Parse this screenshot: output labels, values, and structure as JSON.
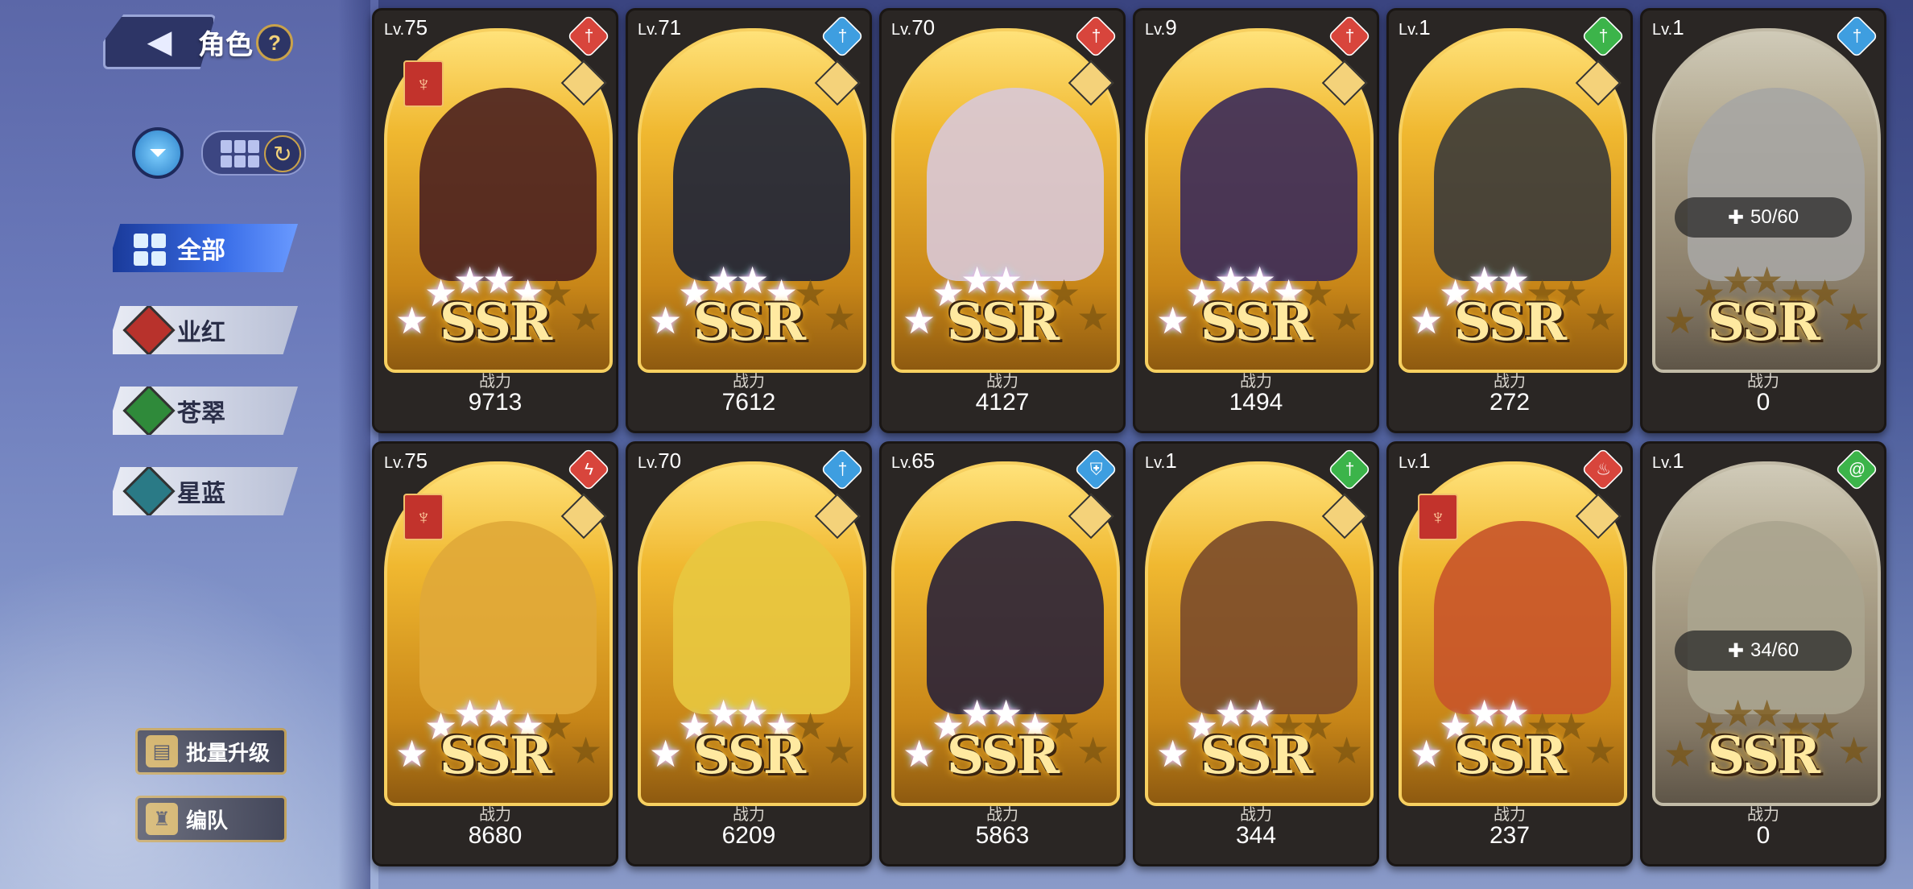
{
  "header": {
    "title": "角色",
    "help_label": "?"
  },
  "categories": [
    {
      "label": "全部",
      "active": true
    },
    {
      "label": "业红",
      "gem_color": "#b8322c"
    },
    {
      "label": "苍翠",
      "gem_color": "#2f8a3a"
    },
    {
      "label": "星蓝",
      "gem_color": "#2a7a86"
    }
  ],
  "buttons": {
    "batch_upgrade": "批量升级",
    "team": "编队"
  },
  "rarity_label": "SSR",
  "power_label": "战力",
  "level_prefix": "Lv.",
  "colors": {
    "red": "#d8453c",
    "blue": "#3e9ee0",
    "green": "#3cb44a",
    "gold": "#f0b830"
  },
  "cards": [
    {
      "level": "75",
      "element": "red",
      "element_icon": "sword-icon",
      "badge": true,
      "stars": 5,
      "power": "9713",
      "portrait": "#4a2020"
    },
    {
      "level": "71",
      "element": "blue",
      "element_icon": "sword-icon",
      "badge": false,
      "stars": 5,
      "power": "7612",
      "portrait": "#1c2238"
    },
    {
      "level": "70",
      "element": "red",
      "element_icon": "sword-icon",
      "badge": false,
      "stars": 5,
      "power": "4127",
      "portrait": "#d8c8d8"
    },
    {
      "level": "9",
      "element": "red",
      "element_icon": "sword-icon",
      "badge": false,
      "stars": 5,
      "power": "1494",
      "portrait": "#3a2a5a"
    },
    {
      "level": "1",
      "element": "green",
      "element_icon": "sword-icon",
      "badge": false,
      "stars": 4,
      "power": "272",
      "portrait": "#3a3a3a"
    },
    {
      "level": "1",
      "element": "blue",
      "element_icon": "sword-icon",
      "badge": false,
      "stars": 0,
      "power": "0",
      "portrait": "#bfb8a8",
      "fragment": "50/60",
      "locked": true
    },
    {
      "level": "75",
      "element": "red",
      "element_icon": "claw-icon",
      "badge": true,
      "stars": 5,
      "power": "8680",
      "portrait": "#e0a838"
    },
    {
      "level": "70",
      "element": "blue",
      "element_icon": "sword-icon",
      "badge": false,
      "stars": 5,
      "power": "6209",
      "portrait": "#e8c840"
    },
    {
      "level": "65",
      "element": "blue",
      "element_icon": "shield-icon",
      "badge": false,
      "stars": 5,
      "power": "5863",
      "portrait": "#2a2238"
    },
    {
      "level": "1",
      "element": "green",
      "element_icon": "sword-icon",
      "badge": false,
      "stars": 4,
      "power": "344",
      "portrait": "#7a4a2a"
    },
    {
      "level": "1",
      "element": "red",
      "element_icon": "flame-icon",
      "badge": true,
      "stars": 4,
      "power": "237",
      "portrait": "#c8542a"
    },
    {
      "level": "1",
      "element": "green",
      "element_icon": "swirl-icon",
      "badge": false,
      "stars": 0,
      "power": "0",
      "portrait": "#d8b840",
      "fragment": "34/60",
      "locked": true
    }
  ]
}
